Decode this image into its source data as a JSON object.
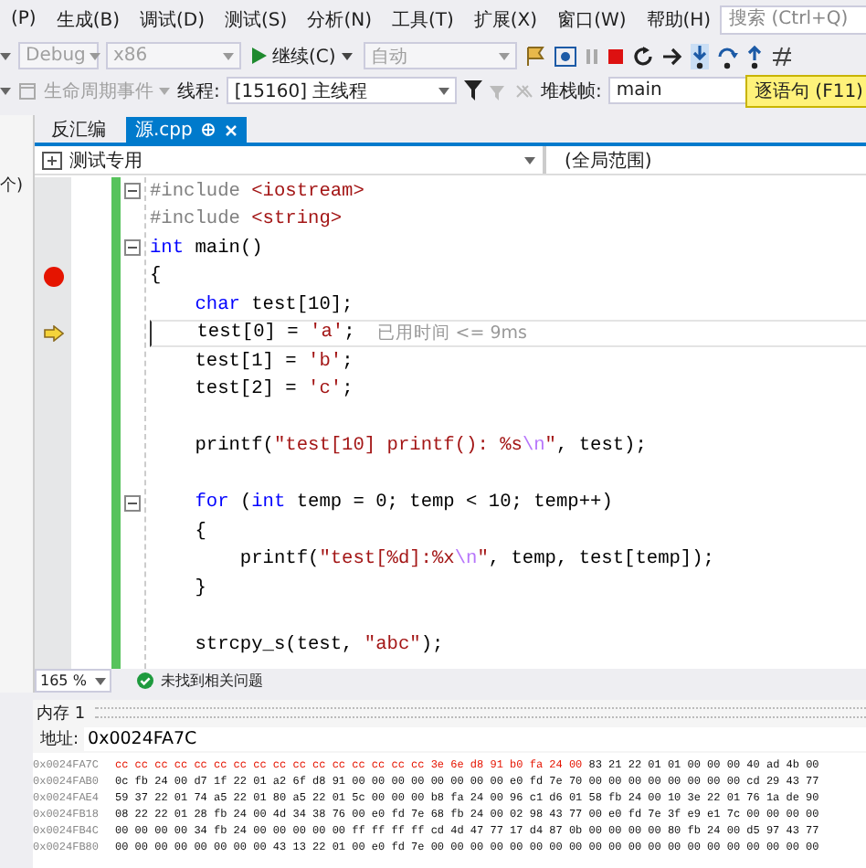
{
  "menu": [
    "(P)",
    "生成(B)",
    "调试(D)",
    "测试(S)",
    "分析(N)",
    "工具(T)",
    "扩展(X)",
    "窗口(W)",
    "帮助(H)"
  ],
  "search": {
    "placeholder": "搜索 (Ctrl+Q)"
  },
  "toolbar": {
    "config": "Debug",
    "platform": "x86",
    "continue": "继续(C)",
    "target": "自动"
  },
  "debug_bar": {
    "lifecycle": "生命周期事件",
    "thread_label": "线程:",
    "thread": "[15160] 主线程",
    "frame_label": "堆栈帧:",
    "frame": "main",
    "tooltip": "逐语句 (F11)"
  },
  "left_panel": {
    "fragment": "个)"
  },
  "tabs": [
    {
      "label": "反汇编",
      "selected": false,
      "closable": false
    },
    {
      "label": "源.cpp",
      "selected": true,
      "closable": true
    }
  ],
  "nav": {
    "project": "测试专用",
    "scope": "(全局范围)"
  },
  "code": [
    {
      "kind": "code",
      "fold": true,
      "breakpoint": false,
      "current": false,
      "tokens": [
        {
          "kind": "pre",
          "t": "#include "
        },
        {
          "kind": "str",
          "t": "<iostream>"
        }
      ]
    },
    {
      "kind": "code",
      "fold": false,
      "breakpoint": false,
      "current": false,
      "tokens": [
        {
          "kind": "pre",
          "t": "#include "
        },
        {
          "kind": "str",
          "t": "<string>"
        }
      ]
    },
    {
      "kind": "code",
      "fold": true,
      "breakpoint": false,
      "current": false,
      "tokens": [
        {
          "kind": "kw",
          "t": "int"
        },
        {
          "kind": "id",
          "t": " main()"
        }
      ]
    },
    {
      "kind": "code",
      "fold": false,
      "breakpoint": true,
      "current": false,
      "tokens": [
        {
          "kind": "id",
          "t": "{"
        }
      ]
    },
    {
      "kind": "code",
      "fold": false,
      "breakpoint": false,
      "current": false,
      "tokens": [
        {
          "kind": "kw",
          "t": "    char"
        },
        {
          "kind": "id",
          "t": " test[10];"
        }
      ]
    },
    {
      "kind": "code",
      "fold": false,
      "breakpoint": false,
      "current": true,
      "note": "已用时间 <= 9ms",
      "tokens": [
        {
          "kind": "id",
          "t": "    test[0] = "
        },
        {
          "kind": "str",
          "t": "'a'"
        },
        {
          "kind": "id",
          "t": ";"
        }
      ]
    },
    {
      "kind": "code",
      "fold": false,
      "breakpoint": false,
      "current": false,
      "tokens": [
        {
          "kind": "id",
          "t": "    test[1] = "
        },
        {
          "kind": "str",
          "t": "'b'"
        },
        {
          "kind": "id",
          "t": ";"
        }
      ]
    },
    {
      "kind": "code",
      "fold": false,
      "breakpoint": false,
      "current": false,
      "tokens": [
        {
          "kind": "id",
          "t": "    test[2] = "
        },
        {
          "kind": "str",
          "t": "'c'"
        },
        {
          "kind": "id",
          "t": ";"
        }
      ]
    },
    {
      "kind": "blank"
    },
    {
      "kind": "code",
      "fold": false,
      "breakpoint": false,
      "current": false,
      "tokens": [
        {
          "kind": "id",
          "t": "    printf("
        },
        {
          "kind": "str",
          "t": "\"test[10] printf(): %s"
        },
        {
          "kind": "esc",
          "t": "\\n"
        },
        {
          "kind": "str",
          "t": "\""
        },
        {
          "kind": "id",
          "t": ", test);"
        }
      ]
    },
    {
      "kind": "blank"
    },
    {
      "kind": "code",
      "fold": true,
      "breakpoint": false,
      "current": false,
      "tokens": [
        {
          "kind": "kw",
          "t": "    for"
        },
        {
          "kind": "id",
          "t": " ("
        },
        {
          "kind": "kw",
          "t": "int"
        },
        {
          "kind": "id",
          "t": " temp = 0; temp < 10; temp++)"
        }
      ]
    },
    {
      "kind": "code",
      "fold": false,
      "breakpoint": false,
      "current": false,
      "tokens": [
        {
          "kind": "id",
          "t": "    {"
        }
      ]
    },
    {
      "kind": "code",
      "fold": false,
      "breakpoint": false,
      "current": false,
      "tokens": [
        {
          "kind": "id",
          "t": "        printf("
        },
        {
          "kind": "str",
          "t": "\"test[%d]:%x"
        },
        {
          "kind": "esc",
          "t": "\\n"
        },
        {
          "kind": "str",
          "t": "\""
        },
        {
          "kind": "id",
          "t": ", temp, test[temp]);"
        }
      ]
    },
    {
      "kind": "code",
      "fold": false,
      "breakpoint": false,
      "current": false,
      "tokens": [
        {
          "kind": "id",
          "t": "    }"
        }
      ]
    },
    {
      "kind": "blank"
    },
    {
      "kind": "code",
      "fold": false,
      "breakpoint": false,
      "current": false,
      "tokens": [
        {
          "kind": "id",
          "t": "    strcpy_s(test, "
        },
        {
          "kind": "str",
          "t": "\"abc\""
        },
        {
          "kind": "id",
          "t": ");"
        }
      ]
    }
  ],
  "status": {
    "zoom": "165 %",
    "issues": "未找到相关问题"
  },
  "memory": {
    "title": "内存 1",
    "address_label": "地址:",
    "address": "0x0024FA7C",
    "rows": [
      {
        "address": "0x0024FA7C",
        "changed": "cc cc cc cc cc cc cc cc cc cc cc cc cc cc cc cc 3e 6e d8 91 b0 fa 24 00",
        "bytes": "83 21 22 01 01 00 00 00 40 ad 4b 00"
      },
      {
        "address": "0x0024FAB0",
        "bytes": "0c fb 24 00 d7 1f 22 01 a2 6f d8 91 00 00 00 00 00 00 00 00 e0 fd 7e 70 00 00 00 00 00 00 00 00 cd 29 43 77"
      },
      {
        "address": "0x0024FAE4",
        "bytes": "59 37 22 01 74 a5 22 01 80 a5 22 01 5c 00 00 00 b8 fa 24 00 96 c1 d6 01 58 fb 24 00 10 3e 22 01 76 1a de 90"
      },
      {
        "address": "0x0024FB18",
        "bytes": "08 22 22 01 28 fb 24 00 4d 34 38 76 00 e0 fd 7e 68 fb 24 00 02 98 43 77 00 e0 fd 7e 3f e9 e1 7c 00 00 00 00"
      },
      {
        "address": "0x0024FB4C",
        "bytes": "00 00 00 00 34 fb 24 00 00 00 00 00 ff ff ff ff cd 4d 47 77 17 d4 87 0b 00 00 00 00 80 fb 24 00 d5 97 43 77"
      },
      {
        "address": "0x0024FB80",
        "bytes": "00 00 00 00 00 00 00 00 43 13 22 01 00 e0 fd 7e 00 00 00 00 00 00 00 00 00 00 00 00 00 00 00 00 00 00 00 00"
      }
    ]
  }
}
